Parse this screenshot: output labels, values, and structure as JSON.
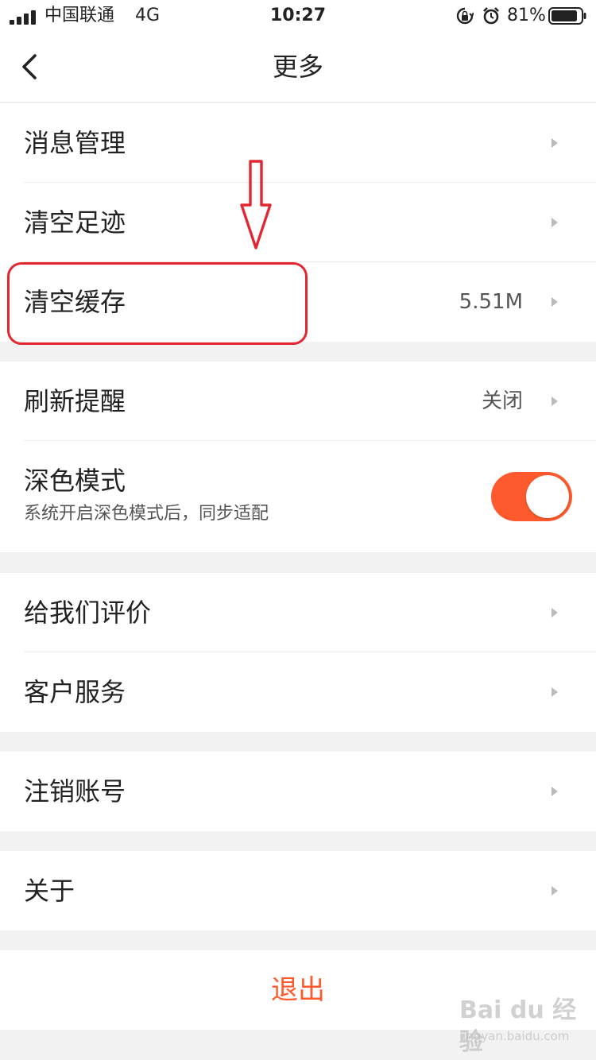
{
  "status_bar": {
    "carrier": "中国联通",
    "network": "4G",
    "time": "10:27",
    "battery_percent": "81%",
    "icons": [
      "signal-icon",
      "rotation-lock-icon",
      "alarm-icon",
      "battery-icon"
    ]
  },
  "nav": {
    "title": "更多",
    "back_icon": "chevron-left-icon"
  },
  "groups": [
    {
      "items": [
        {
          "label": "消息管理",
          "value": ""
        },
        {
          "label": "清空足迹",
          "value": ""
        },
        {
          "label": "清空缓存",
          "value": "5.51M"
        }
      ]
    },
    {
      "items": [
        {
          "label": "刷新提醒",
          "value": "关闭"
        },
        {
          "label": "深色模式",
          "sublabel": "系统开启深色模式后，同步适配",
          "toggle_on": true
        }
      ]
    },
    {
      "items": [
        {
          "label": "给我们评价"
        },
        {
          "label": "客户服务"
        }
      ]
    },
    {
      "items": [
        {
          "label": "注销账号"
        }
      ]
    },
    {
      "items": [
        {
          "label": "关于"
        }
      ]
    }
  ],
  "logout_label": "退出",
  "annotation": {
    "highlighted_item": "清空缓存",
    "color": "#e3262f"
  },
  "watermark": {
    "main": "Bai du 经验",
    "sub": "jingyan.baidu.com"
  },
  "colors": {
    "accent": "#ff5a2d",
    "background": "#f2f2f2",
    "text": "#222222"
  }
}
